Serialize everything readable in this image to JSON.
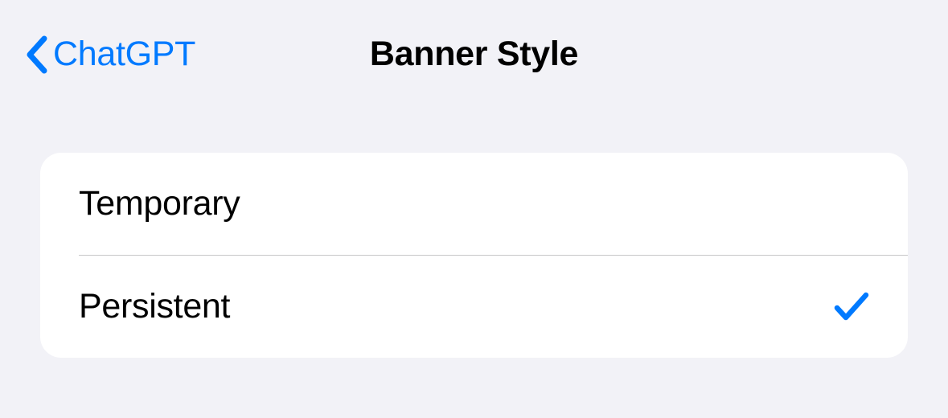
{
  "nav": {
    "back_label": "ChatGPT",
    "title": "Banner Style"
  },
  "options": [
    {
      "label": "Temporary",
      "selected": false
    },
    {
      "label": "Persistent",
      "selected": true
    }
  ],
  "colors": {
    "accent": "#007aff"
  }
}
